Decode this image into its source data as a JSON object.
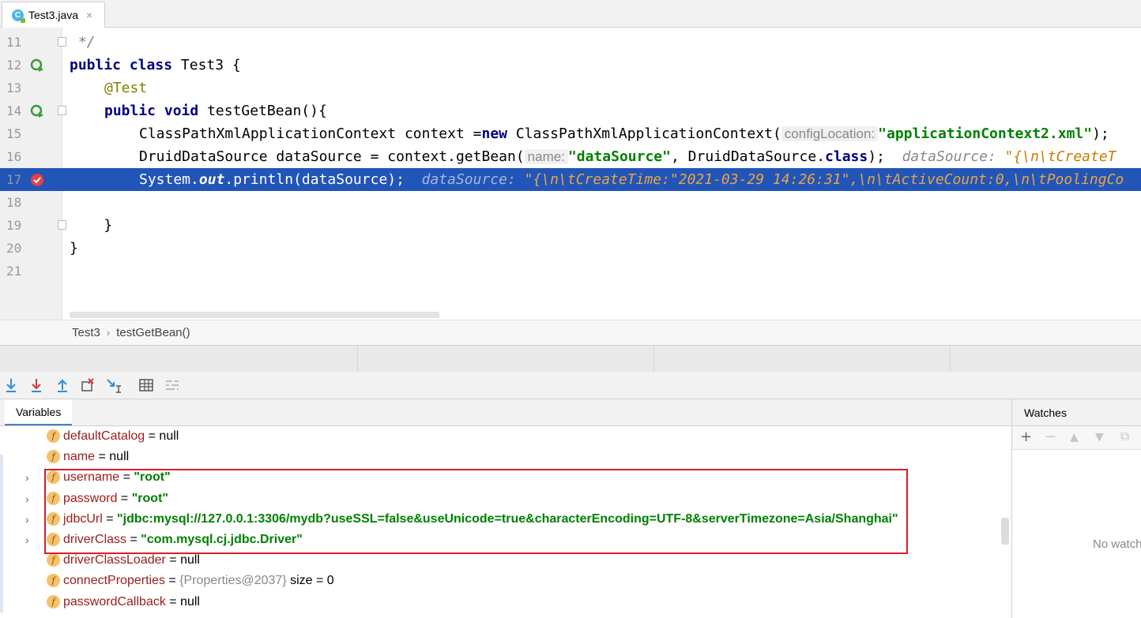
{
  "tab": {
    "icon": "java-class-icon",
    "icon_letter": "C",
    "label": "Test3.java",
    "close": "×"
  },
  "editor": {
    "lines": [
      {
        "n": "11",
        "text": " */"
      },
      {
        "n": "12",
        "kw1": "public",
        "kw2": "class",
        "rest": " Test3 {"
      },
      {
        "n": "13",
        "ann": "@Test"
      },
      {
        "n": "14",
        "kw1": "public",
        "kw2": "void",
        "rest": " testGetBean(){"
      },
      {
        "n": "15",
        "pre": "ClassPathXmlApplicationContext context =",
        "kw": "new",
        "post": " ClassPathXmlApplicationContext(",
        "hint": "configLocation:",
        "str": "\"applicationContext2.xml\"",
        "tail": ");"
      },
      {
        "n": "16",
        "pre": "DruidDataSource dataSource = context.getBean(",
        "hint": "name:",
        "str": "\"dataSource\"",
        "mid": ", DruidDataSource.",
        "kw": "class",
        "tail": ");",
        "inl_label": "dataSource:",
        "inl_value": "\"{\\n\\tCreateT"
      },
      {
        "n": "17",
        "pre": "System.",
        "out": "out",
        "post": ".println(dataSource);",
        "inl_label": "dataSource:",
        "inl_value": "\"{\\n\\tCreateTime:\"2021-03-29 14:26:31\",\\n\\tActiveCount:0,\\n\\tPoolingCo"
      },
      {
        "n": "18"
      },
      {
        "n": "19",
        "text": "    }"
      },
      {
        "n": "20",
        "text": "}"
      },
      {
        "n": "21"
      }
    ]
  },
  "breadcrumb": {
    "class": "Test3",
    "sep": "›",
    "method": "testGetBean()"
  },
  "toolbar": {
    "buttons": [
      "step-over-icon",
      "step-into-icon",
      "step-out-icon",
      "drop-frame-icon",
      "run-to-cursor-icon",
      "evaluate-icon",
      "trace-icon"
    ]
  },
  "variables": {
    "title": "Variables",
    "rows": [
      {
        "name": "defaultCatalog",
        "eq": " = ",
        "value": "null",
        "kind": "null",
        "expand": false
      },
      {
        "name": "name",
        "eq": " = ",
        "value": "null",
        "kind": "null",
        "expand": false
      },
      {
        "name": "username",
        "eq": " = ",
        "value": "\"root\"",
        "kind": "str",
        "expand": true
      },
      {
        "name": "password",
        "eq": " = ",
        "value": "\"root\"",
        "kind": "str",
        "expand": true
      },
      {
        "name": "jdbcUrl",
        "eq": " = ",
        "value": "\"jdbc:mysql://127.0.0.1:3306/mydb?useSSL=false&useUnicode=true&characterEncoding=UTF-8&serverTimezone=Asia/Shanghai\"",
        "kind": "str",
        "expand": true
      },
      {
        "name": "driverClass",
        "eq": " = ",
        "value": "\"com.mysql.cj.jdbc.Driver\"",
        "kind": "str",
        "expand": true
      },
      {
        "name": "driverClassLoader",
        "eq": " = ",
        "value": "null",
        "kind": "null",
        "expand": false
      },
      {
        "name": "connectProperties",
        "eq": " = ",
        "value": "{Properties@2037}",
        "extra": "  size = 0",
        "kind": "obj",
        "expand": false
      },
      {
        "name": "passwordCallback",
        "eq": " = ",
        "value": "null",
        "kind": "null",
        "expand": false
      }
    ],
    "field_badge": "f",
    "expand_glyph": "›"
  },
  "watches": {
    "title": "Watches",
    "buttons": [
      "+",
      "−",
      "▲",
      "▼",
      "⧉"
    ],
    "empty": "No watches"
  },
  "colors": {
    "selection": "#2255b8",
    "highlight_box": "#d81e27",
    "string": "#008000",
    "keyword": "#000080"
  }
}
